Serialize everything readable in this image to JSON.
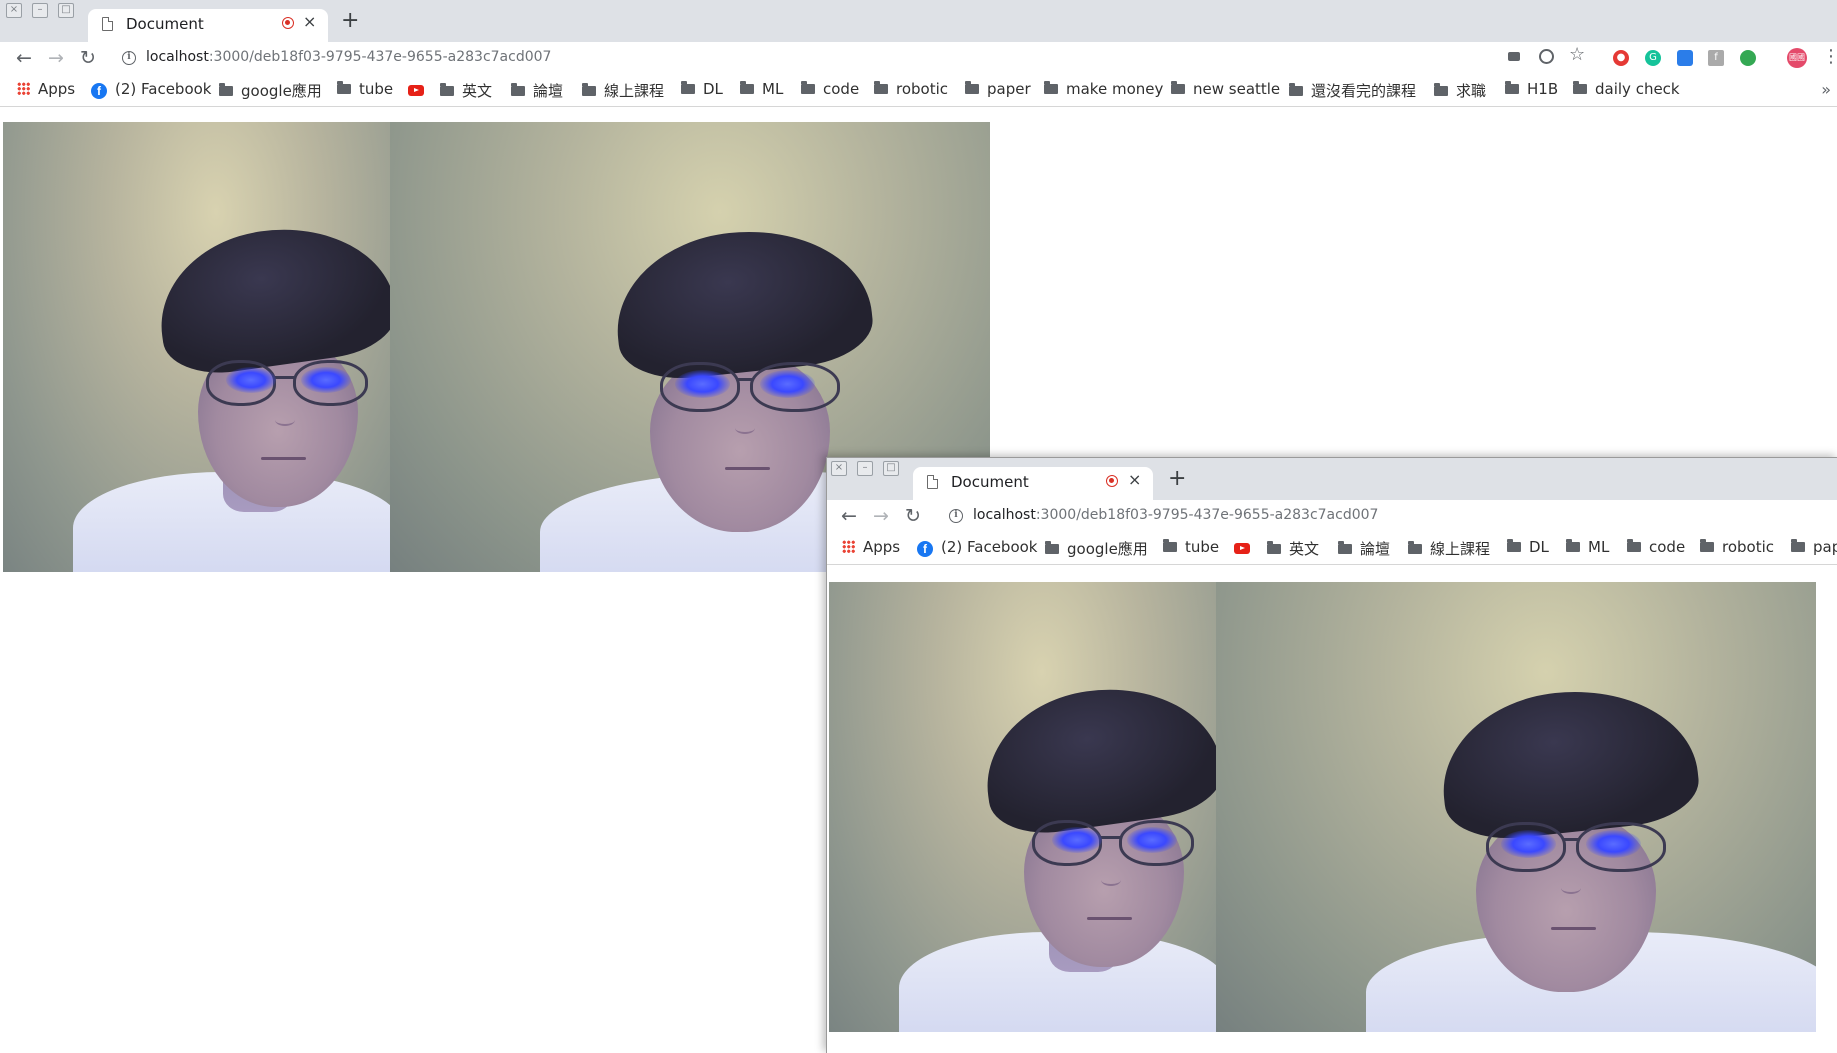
{
  "browser": {
    "tab_title": "Document",
    "new_tab_label": "+",
    "close_label": "×",
    "url_host": "localhost",
    "url_path": ":3000/deb18f03-9795-437e-9655-a283c7acd007",
    "nav": {
      "back": "←",
      "forward": "→",
      "reload": "↻"
    },
    "bookmarks": [
      {
        "label": "Apps",
        "icon": "apps-grid-icon"
      },
      {
        "label": "(2) Facebook",
        "icon": "facebook-icon"
      },
      {
        "label": "google應用",
        "icon": "folder-icon"
      },
      {
        "label": "tube",
        "icon": "folder-icon"
      },
      {
        "label": "",
        "icon": "youtube-icon"
      },
      {
        "label": "英文",
        "icon": "folder-icon"
      },
      {
        "label": "論壇",
        "icon": "folder-icon"
      },
      {
        "label": "線上課程",
        "icon": "folder-icon"
      },
      {
        "label": "DL",
        "icon": "folder-icon"
      },
      {
        "label": "ML",
        "icon": "folder-icon"
      },
      {
        "label": "code",
        "icon": "folder-icon"
      },
      {
        "label": "robotic",
        "icon": "folder-icon"
      },
      {
        "label": "paper",
        "icon": "folder-icon"
      },
      {
        "label": "make money",
        "icon": "folder-icon"
      },
      {
        "label": "new seattle",
        "icon": "folder-icon"
      },
      {
        "label": "還沒看完的課程",
        "icon": "folder-icon"
      },
      {
        "label": "求職",
        "icon": "folder-icon"
      },
      {
        "label": "H1B",
        "icon": "folder-icon"
      },
      {
        "label": "daily check",
        "icon": "folder-icon"
      }
    ],
    "second_window_last_bookmark": "pap",
    "more_bookmarks": "»",
    "profile_label": "國國",
    "menu": "⋮",
    "colors": {
      "tabstrip": "#dee1e6",
      "record": "#d93025",
      "facebook": "#1877f2",
      "youtube": "#e62117"
    }
  },
  "icons": [
    "camera-icon",
    "zoom-icon",
    "star-icon",
    "adblock-icon",
    "grammarly-icon",
    "extension-icon",
    "facebook-ext-icon",
    "green-ext-icon",
    "profile-avatar",
    "menu-icon"
  ]
}
